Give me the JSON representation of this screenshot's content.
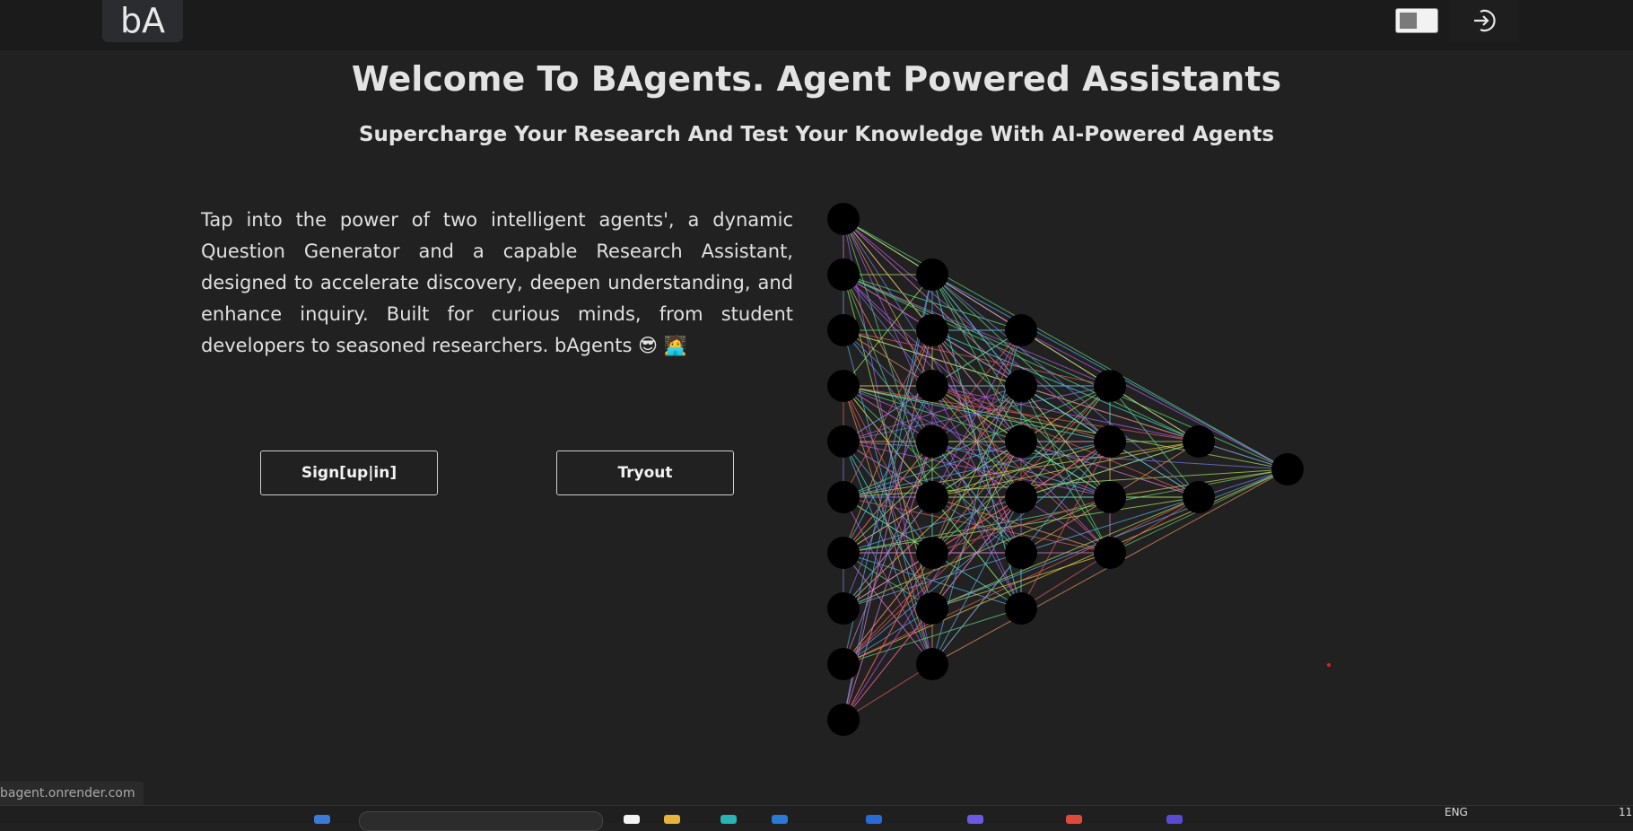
{
  "header": {
    "logo_text": "bA",
    "theme_toggle_icon": "toggle-switch-icon",
    "login_icon": "login-arrow-icon"
  },
  "hero": {
    "title": "Welcome To BAgents. Agent Powered Assistants",
    "subtitle": "Supercharge Your Research And Test Your Knowledge With AI-Powered Agents",
    "description": "Tap into the power of two intelligent agents', a dynamic Question Generator and a capable Research Assistant, designed to accelerate discovery, deepen understanding, and enhance inquiry. Built for curious minds, from student developers to seasoned researchers. bAgents 😎 🧑‍💻"
  },
  "actions": {
    "signup_label": "Sign[up|in]",
    "tryout_label": "Tryout"
  },
  "network": {
    "layer_sizes": [
      10,
      8,
      6,
      4,
      2,
      1
    ],
    "edge_colors": [
      "#e05a5a",
      "#e0c64a",
      "#5ad17a",
      "#5aa8e0",
      "#b35ae0",
      "#e07ad1",
      "#4ae0d6",
      "#a8e05a",
      "#e0925a",
      "#7a7ae0"
    ]
  },
  "status_bar": {
    "url": "bagent.onrender.com"
  },
  "taskbar": {
    "language": "ENG",
    "clock": "11"
  },
  "colors": {
    "background": "#212121",
    "topbar": "#1b1b1b",
    "node": "#000000"
  }
}
